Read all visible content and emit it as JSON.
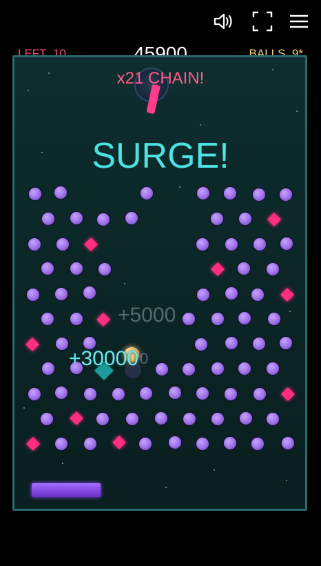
{
  "topbar": {
    "sound_icon": "speaker-icon",
    "fullscreen_icon": "fullscreen-icon",
    "menu_icon": "hamburger-menu-icon"
  },
  "hud": {
    "left_label": "LEFT",
    "left_value": "10",
    "score": "45900",
    "balls_label": "BALLS",
    "balls_value": "9*"
  },
  "popups": {
    "chain": "x21  CHAIN!",
    "surge": "SURGE!",
    "bonus_faded": "+5000",
    "bonus_main": "+30000",
    "bonus_trail": "0"
  },
  "colors": {
    "left_text": "#ff4d7a",
    "balls_text": "#f3d27a",
    "chain_text": "#ff5c8a",
    "surge_text": "#4de3e3",
    "peg": "#9c6fe6",
    "diamond": "#ff2f7e",
    "paddle": "#8a4dff",
    "border": "#2a6a6a"
  }
}
